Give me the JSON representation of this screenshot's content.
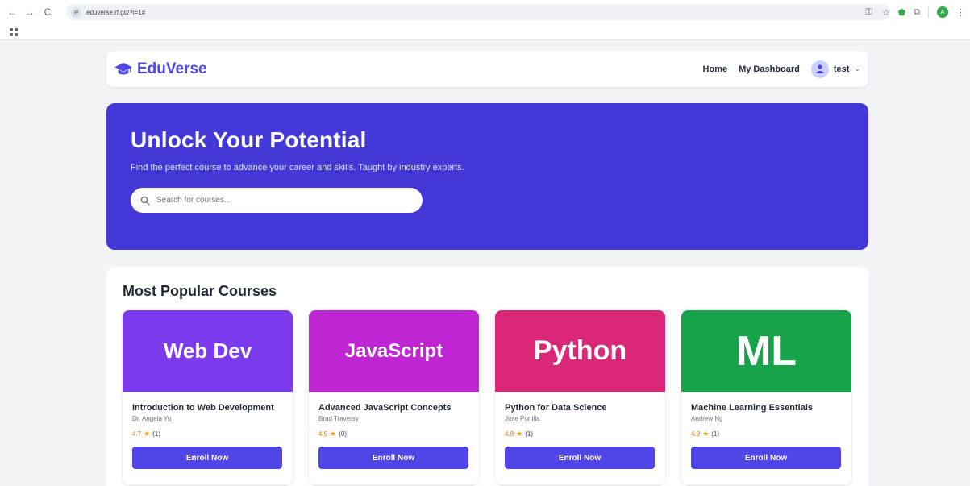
{
  "browser": {
    "url": "eduverse.rf.gd/?i=1#",
    "back_glyph": "←",
    "forward_glyph": "→",
    "reload_glyph": "C",
    "profile_initial": "A"
  },
  "header": {
    "brand": "EduVerse",
    "nav": [
      "Home",
      "My Dashboard"
    ],
    "username": "test"
  },
  "hero": {
    "title": "Unlock Your Potential",
    "subtitle": "Find the perfect course to advance your career and skills. Taught by industry experts.",
    "search_placeholder": "Search for courses...",
    "background": "#4338d6"
  },
  "popular": {
    "heading": "Most Popular Courses",
    "enroll_label": "Enroll Now",
    "courses": [
      {
        "thumb": "Web Dev",
        "color": "#7c3aed",
        "title": "Introduction to Web Development",
        "instructor": "Dr. Angela Yu",
        "rating": "4.7",
        "reviews": "(1)"
      },
      {
        "thumb": "JavaScript",
        "color": "#c026d3",
        "title": "Advanced JavaScript Concepts",
        "instructor": "Brad Traversy",
        "rating": "4.9",
        "reviews": "(0)"
      },
      {
        "thumb": "Python",
        "color": "#db2777",
        "title": "Python for Data Science",
        "instructor": "Jose Portilla",
        "rating": "4.8",
        "reviews": "(1)"
      },
      {
        "thumb": "ML",
        "color": "#16a34a",
        "title": "Machine Learning Essentials",
        "instructor": "Andrew Ng",
        "rating": "4.9",
        "reviews": "(1)"
      }
    ]
  },
  "colors": {
    "accent": "#4f46e5",
    "star": "#f59e0b"
  }
}
